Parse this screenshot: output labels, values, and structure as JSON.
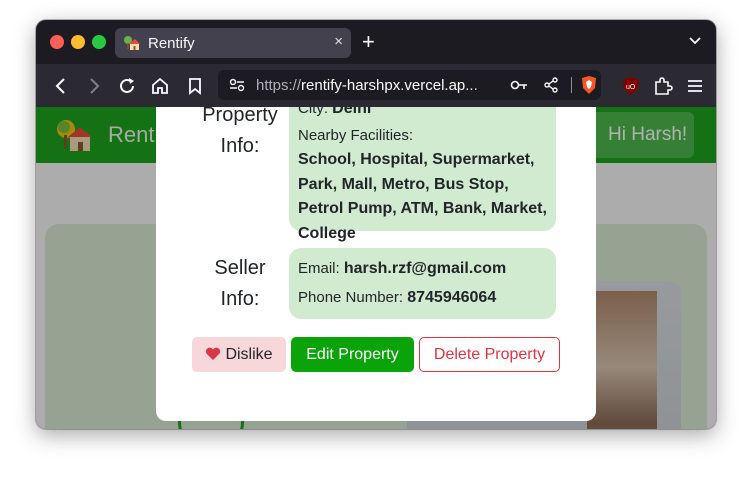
{
  "browser": {
    "tab_title": "Rentify",
    "close_tab": "×",
    "new_tab": "+",
    "url_protocol": "https://",
    "url_rest": "rentify-harshpx.vercel.ap..."
  },
  "site": {
    "brand": "Rentify",
    "greeting": "Hi Harsh!"
  },
  "modal": {
    "property_label_1": "Property",
    "property_label_2": "Info:",
    "city_label": "City:",
    "city_value": "Delhi",
    "facilities_label": "Nearby Facilities:",
    "facilities_value": "School, Hospital, Supermarket, Park, Mall, Metro, Bus Stop, Petrol Pump, ATM, Bank, Market, College",
    "seller_label_1": "Seller",
    "seller_label_2": "Info:",
    "email_label": "Email:",
    "email_value": "harsh.rzf@gmail.com",
    "phone_label": "Phone Number:",
    "phone_value": "8745946064",
    "dislike_label": "Dislike",
    "edit_label": "Edit Property",
    "delete_label": "Delete Property"
  },
  "colors": {
    "header_green": "#1ea21e",
    "edit_green": "#0aa30a",
    "info_box": "#d1ebd0",
    "delete_red": "#dc3545",
    "dislike_bg": "#f8d7da"
  }
}
